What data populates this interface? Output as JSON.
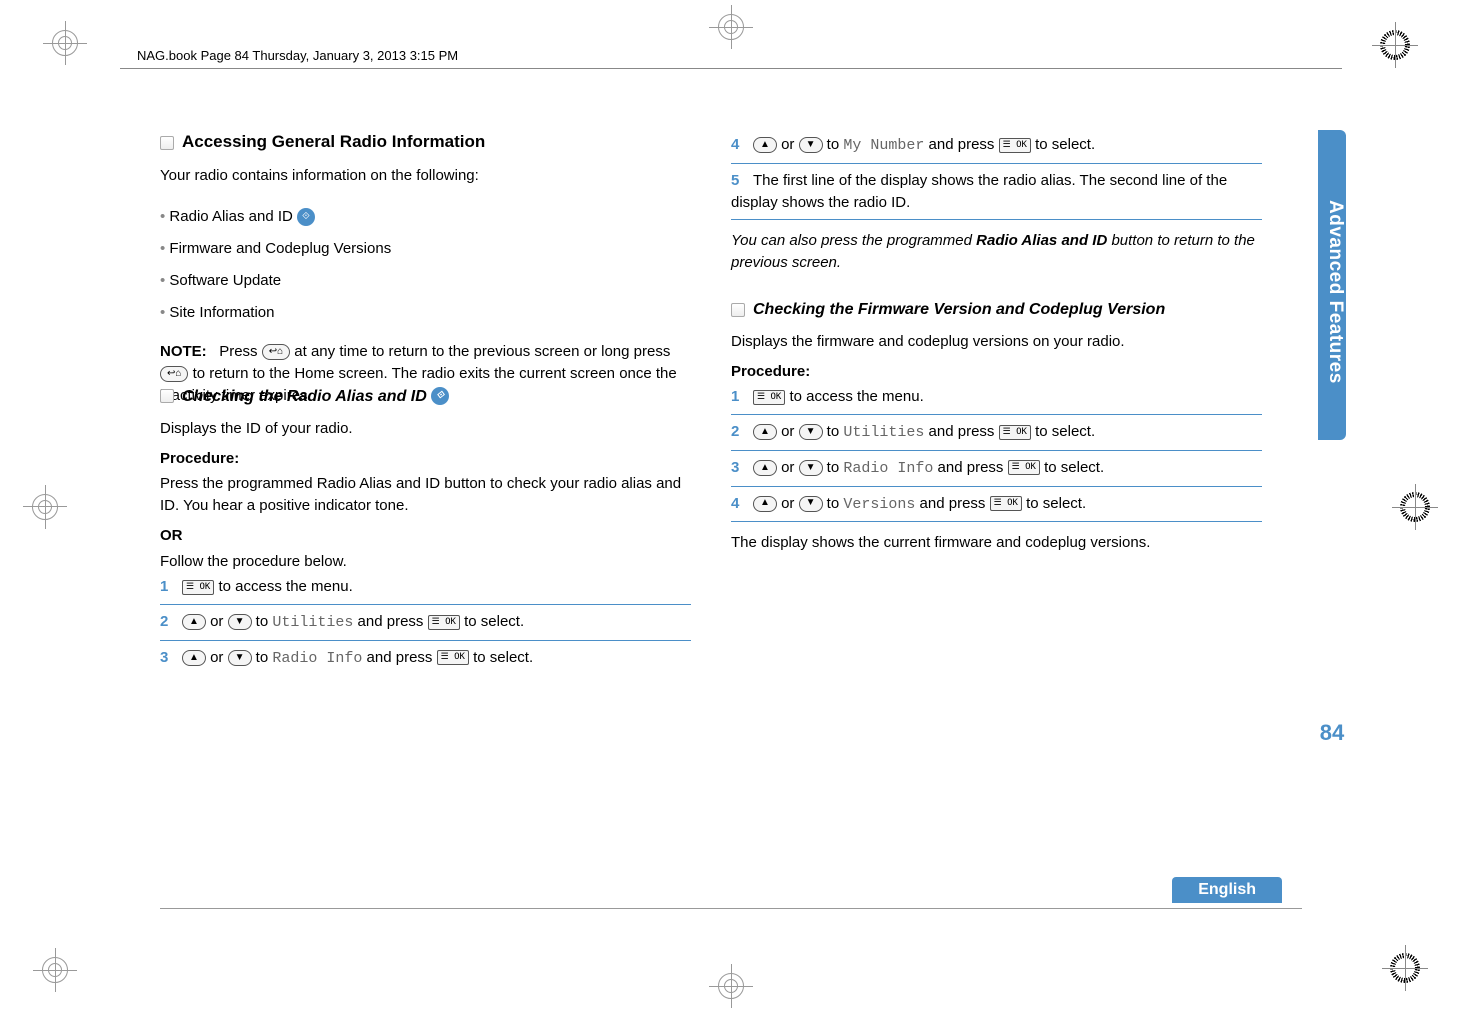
{
  "header": "NAG.book  Page 84  Thursday, January 3, 2013  3:15 PM",
  "sideTab": "Advanced Features",
  "pageNum": "84",
  "lang": "English",
  "left": {
    "secTitle": "Accessing General Radio Information",
    "intro": "Your radio contains information on the following:",
    "bullets": [
      "Radio Alias and ID",
      "Firmware and Codeplug Versions",
      "Software Update",
      "Site Information"
    ],
    "noteLabel": "NOTE:",
    "noteBody1": "Press ",
    "noteBody2": " at any time to return to the previous screen or long press ",
    "noteBody3": " to return to the Home screen. The radio exits the current screen once the inactivity timer expires.",
    "subTitle": "Checking the Radio Alias and ID",
    "subIntro": "Displays the ID of your radio.",
    "procLabel": "Procedure:",
    "procBody": "Press the programmed Radio Alias and ID button to check your radio alias and ID. You hear a positive indicator tone.",
    "or": "OR",
    "follow": "Follow the procedure below.",
    "steps": [
      {
        "n": "1",
        "pre": "",
        "mid": " to access the menu.",
        "mono": ""
      },
      {
        "n": "2",
        "pre": " or ",
        "mid": " to ",
        "mono": "Utilities",
        "post": " and press ",
        "tail": " to select."
      },
      {
        "n": "3",
        "pre": " or ",
        "mid": " to ",
        "mono": "Radio Info",
        "post": " and press ",
        "tail": " to select."
      }
    ]
  },
  "right": {
    "step4": {
      "n": "4",
      "pre": " or ",
      "mid": " to ",
      "mono": "My Number",
      "post": " and press ",
      "tail": " to select."
    },
    "step5": {
      "n": "5",
      "body": "The first line of the display shows the radio alias. The second line of the display shows the radio ID."
    },
    "italicNote1": "You can also press the programmed ",
    "italicBold": "Radio Alias and ID",
    "italicNote2": " button to return to the previous screen.",
    "subTitle": "Checking the Firmware Version and Codeplug Version",
    "subIntro": "Displays the firmware and codeplug versions on your radio.",
    "procLabel": "Procedure:",
    "steps": [
      {
        "n": "1",
        "mid": " to access the menu."
      },
      {
        "n": "2",
        "pre": " or ",
        "mid": " to ",
        "mono": "Utilities",
        "post": " and press ",
        "tail": " to select."
      },
      {
        "n": "3",
        "pre": " or ",
        "mid": " to ",
        "mono": "Radio Info",
        "post": " and press ",
        "tail": " to select."
      },
      {
        "n": "4",
        "pre": " or ",
        "mid": " to ",
        "mono": "Versions",
        "post": " and press ",
        "tail": " to select."
      }
    ],
    "closing": "The display shows the current firmware and codeplug versions."
  },
  "icons": {
    "ok": "☰ OK",
    "back": "↩⌂",
    "up": "▲",
    "down": "▼"
  }
}
